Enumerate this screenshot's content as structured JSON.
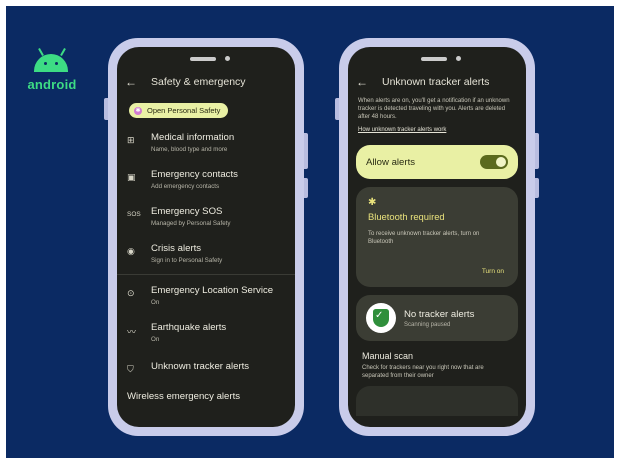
{
  "brand": {
    "wordmark": "android",
    "color": "#3ddc84"
  },
  "colors": {
    "background": "#0b2a63",
    "phone_frame": "#c9ccea",
    "screen": "#1f201c",
    "accent": "#e9f0a4",
    "accent_text": "#e9e27c"
  },
  "left_screen": {
    "title": "Safety & emergency",
    "back_icon": "arrow-left-icon",
    "pill_label": "Open Personal Safety",
    "items": [
      {
        "icon": "medical-id-icon",
        "glyph": "⊞",
        "title": "Medical information",
        "subtitle": "Name, blood type and more"
      },
      {
        "icon": "contact-card-icon",
        "glyph": "▣",
        "title": "Emergency contacts",
        "subtitle": "Add emergency contacts"
      },
      {
        "icon": "sos-icon",
        "glyph": "SOS",
        "title": "Emergency SOS",
        "subtitle": "Managed by Personal Safety"
      },
      {
        "icon": "crisis-alert-icon",
        "glyph": "◉",
        "title": "Crisis alerts",
        "subtitle": "Sign in to Personal Safety"
      },
      {
        "icon": "location-pin-icon",
        "glyph": "⊙",
        "title": "Emergency Location Service",
        "subtitle": "On"
      },
      {
        "icon": "earthquake-icon",
        "glyph": "〰",
        "title": "Earthquake alerts",
        "subtitle": "On"
      },
      {
        "icon": "shield-icon",
        "glyph": "⛉",
        "title": "Unknown tracker alerts",
        "subtitle": ""
      }
    ],
    "section_title": "Wireless emergency alerts"
  },
  "right_screen": {
    "title": "Unknown tracker alerts",
    "back_icon": "arrow-left-icon",
    "description": "When alerts are on, you'll get a notification if an unknown tracker is detected traveling with you. Alerts are deleted after 48 hours.",
    "link": "How unknown tracker alerts work",
    "allow_label": "Allow alerts",
    "allow_on": true,
    "bluetooth": {
      "icon": "bluetooth-icon",
      "title": "Bluetooth required",
      "text": "To receive unknown tracker alerts, turn on Bluetooth",
      "action": "Turn on"
    },
    "status": {
      "icon": "shield-check-icon",
      "title": "No tracker alerts",
      "subtitle": "Scanning paused"
    },
    "manual": {
      "title": "Manual scan",
      "text": "Check for trackers near you right now that are separated from their owner"
    }
  }
}
